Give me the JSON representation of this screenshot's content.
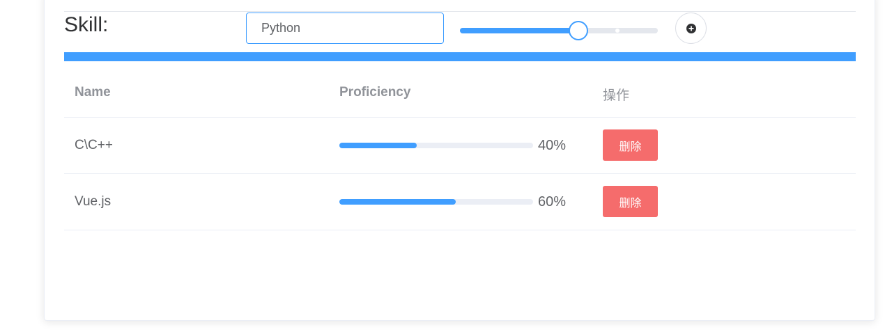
{
  "form": {
    "label": "Skill:",
    "input_value": "Python",
    "slider_value_percent": 60,
    "add_icon": "plus-circle-icon"
  },
  "colors": {
    "primary": "#409eff",
    "danger": "#f56c6c",
    "track": "#e4e7ed"
  },
  "table": {
    "headers": {
      "name": "Name",
      "proficiency": "Proficiency",
      "actions": "操作"
    },
    "rows": [
      {
        "name": "C\\C++",
        "proficiency": 40,
        "proficiency_label": "40%",
        "delete_label": "删除"
      },
      {
        "name": "Vue.js",
        "proficiency": 60,
        "proficiency_label": "60%",
        "delete_label": "删除"
      }
    ]
  }
}
